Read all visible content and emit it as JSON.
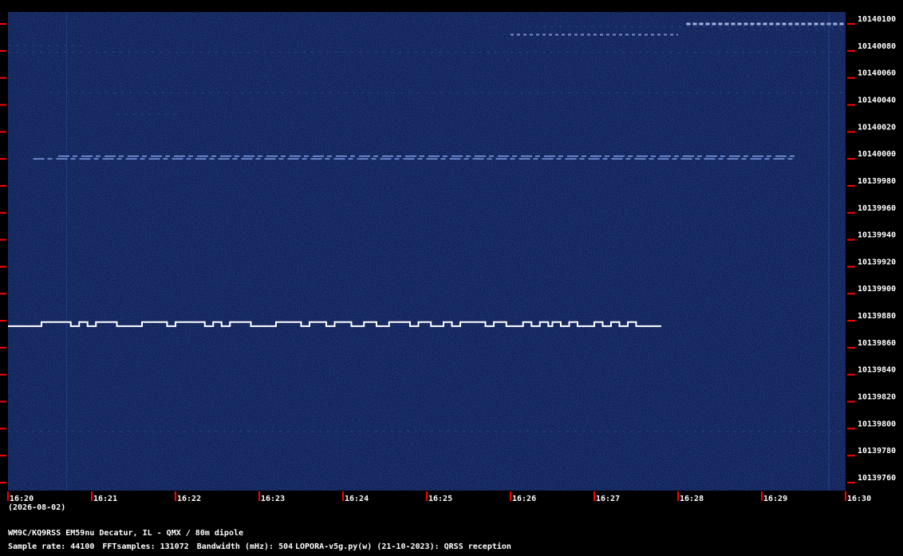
{
  "chart_data": {
    "type": "heatmap",
    "title": "",
    "y_axis": {
      "unit": "Hz",
      "ylim": [
        10139760,
        10140100
      ],
      "tick_labels": [
        "10140100",
        "10140080",
        "10140060",
        "10140040",
        "10140020",
        "10140000",
        "10139980",
        "10139960",
        "10139940",
        "10139920",
        "10139900",
        "10139880",
        "10139860",
        "10139840",
        "10139820",
        "10139800",
        "10139780",
        "10139760"
      ]
    },
    "x_axis": {
      "xlim": [
        "16:20",
        "16:30"
      ],
      "tick_labels": [
        "16:20",
        "16:21",
        "16:22",
        "16:23",
        "16:24",
        "16:25",
        "16:26",
        "16:27",
        "16:28",
        "16:29",
        "16:30"
      ]
    },
    "signals": [
      {
        "type": "fsk_cw",
        "base_freq": 10139876,
        "shift_hz": 3,
        "start": "16:20.0",
        "end": "16:27.8",
        "high_segments_min": [
          [
            0.4,
            0.75
          ],
          [
            0.85,
            0.95
          ],
          [
            1.05,
            1.3
          ],
          [
            1.6,
            1.9
          ],
          [
            2.0,
            2.35
          ],
          [
            2.45,
            2.55
          ],
          [
            2.65,
            2.9
          ],
          [
            3.2,
            3.5
          ],
          [
            3.6,
            3.8
          ],
          [
            3.9,
            4.1
          ],
          [
            4.25,
            4.4
          ],
          [
            4.55,
            4.8
          ],
          [
            4.9,
            5.05
          ],
          [
            5.2,
            5.3
          ],
          [
            5.4,
            5.7
          ],
          [
            5.8,
            5.95
          ],
          [
            6.15,
            6.25
          ],
          [
            6.35,
            6.45
          ],
          [
            6.5,
            6.6
          ],
          [
            6.7,
            6.8
          ],
          [
            7.0,
            7.1
          ],
          [
            7.2,
            7.3
          ],
          [
            7.4,
            7.5
          ]
        ]
      },
      {
        "type": "carrier",
        "freq": 10140000,
        "start": "16:20.3",
        "end": "16:29.4"
      },
      {
        "type": "carrier",
        "freq": 10140002,
        "start": "16:20.6",
        "end": "16:29.4"
      }
    ]
  },
  "footer": {
    "date": "(2026-08-02)",
    "station": "WM9C/KQ9RSS EM59nu Decatur, IL - QMX / 80m dipole",
    "sample_rate": "Sample rate: 44100",
    "fft_samples": "FFTsamples: 131072",
    "bandwidth": "Bandwidth (mHz): 504",
    "software": "LOPORA-v5g.py(w) (21-10-2023): QRSS reception"
  },
  "colors": {
    "background": "#000000",
    "spectrum_bg": "#0c1a52",
    "tick": "#ff0000",
    "signal": "#ffffff"
  }
}
